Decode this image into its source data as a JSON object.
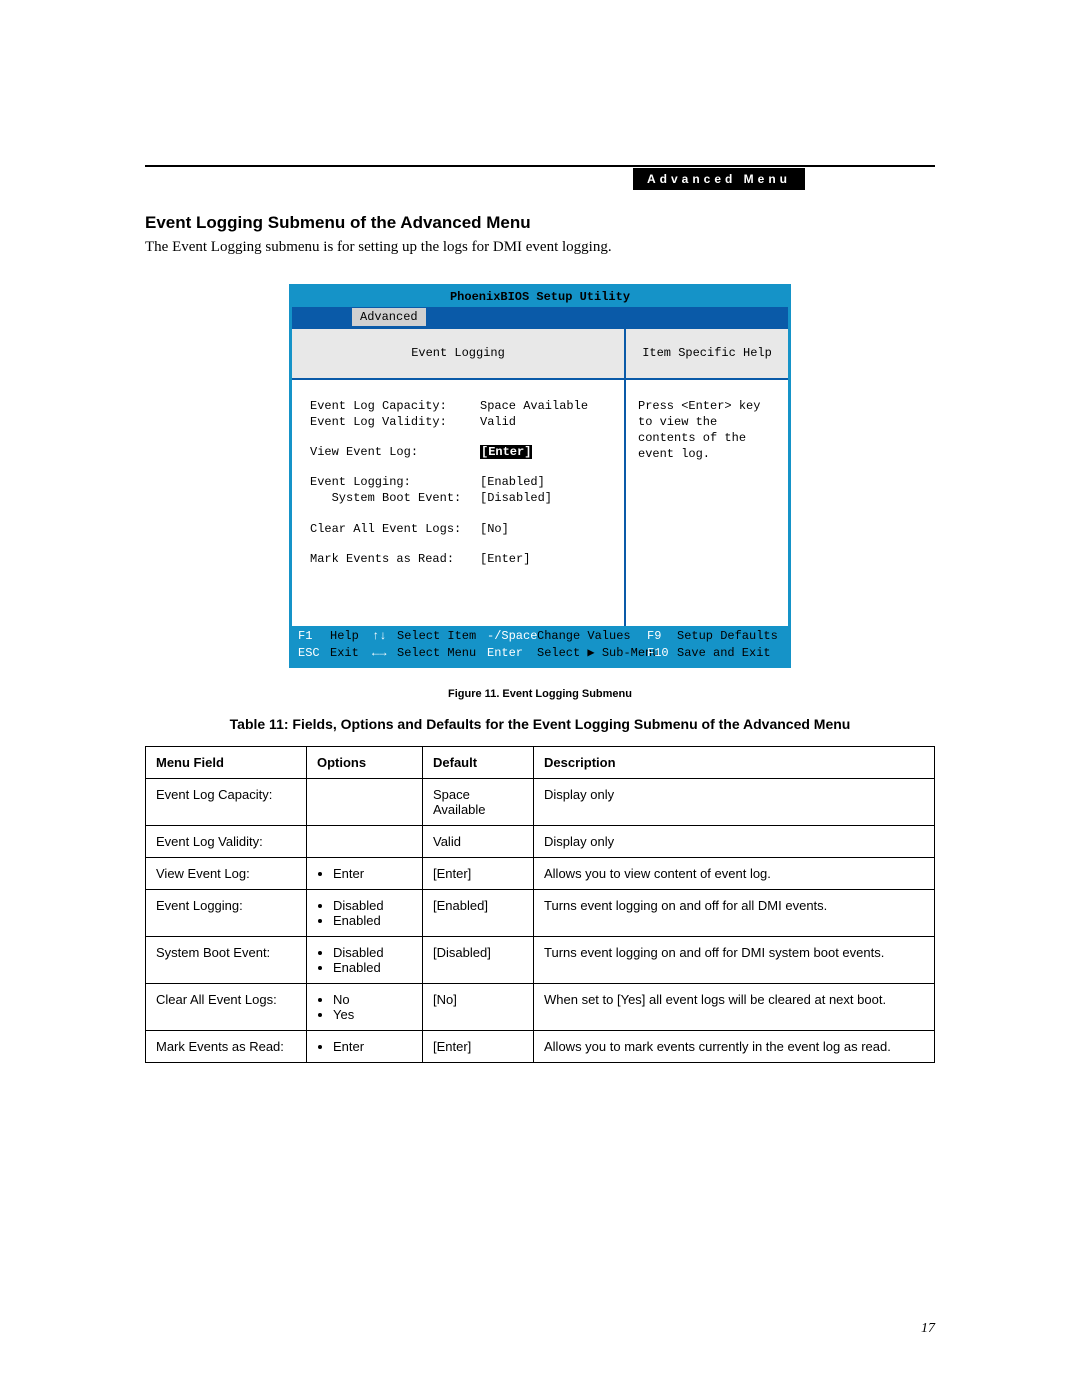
{
  "header": {
    "tab": "Advanced Menu"
  },
  "section": {
    "title": "Event Logging Submenu of the Advanced Menu",
    "intro": "The Event Logging submenu is for setting up the logs for DMI event logging."
  },
  "bios": {
    "title": "PhoenixBIOS Setup Utility",
    "menubar_active": "Advanced",
    "panel_left_title": "Event Logging",
    "panel_right_title": "Item Specific Help",
    "help_text": "Press <Enter> key to view the contents of the event log.",
    "rows": [
      {
        "label": "Event Log Capacity:",
        "value": "Space Available",
        "indent": 0
      },
      {
        "label": "Event Log Validity:",
        "value": "Valid",
        "indent": 0
      },
      {
        "gap": true
      },
      {
        "label": "View Event Log:",
        "value": "[Enter]",
        "indent": 0,
        "selected": true
      },
      {
        "gap": true
      },
      {
        "label": "Event Logging:",
        "value": "[Enabled]",
        "indent": 0
      },
      {
        "label": "System Boot Event:",
        "value": "[Disabled]",
        "indent": 1
      },
      {
        "gap": true
      },
      {
        "label": "Clear All Event Logs:",
        "value": "[No]",
        "indent": 0
      },
      {
        "gap": true
      },
      {
        "label": "Mark Events as Read:",
        "value": "[Enter]",
        "indent": 0
      }
    ],
    "footer": {
      "r1c1k": "F1",
      "r1c1t": "Help",
      "r1c2k": "↑↓",
      "r1c2t": "Select Item",
      "r1c3k": "-/Space",
      "r1c3t": "Change Values",
      "r1c4k": "F9",
      "r1c4t": "Setup Defaults",
      "r2c1k": "ESC",
      "r2c1t": "Exit",
      "r2c2k": "←→",
      "r2c2t": "Select Menu",
      "r2c3k": "Enter",
      "r2c3t": "Select ▶ Sub-Menu",
      "r2c4k": "F10",
      "r2c4t": "Save and Exit"
    }
  },
  "figure_caption": "Figure 11.  Event Logging Submenu",
  "table_title": "Table 11: Fields, Options and Defaults for the Event Logging Submenu of the Advanced Menu",
  "table": {
    "headers": {
      "field": "Menu Field",
      "options": "Options",
      "default": "Default",
      "desc": "Description"
    },
    "rows": [
      {
        "field": "Event Log Capacity:",
        "options": [],
        "default": "Space Available",
        "desc": "Display only"
      },
      {
        "field": "Event Log Validity:",
        "options": [],
        "default": "Valid",
        "desc": "Display only"
      },
      {
        "field": "View Event Log:",
        "options": [
          "Enter"
        ],
        "default": "[Enter]",
        "desc": "Allows you to view content of event log."
      },
      {
        "field": "Event Logging:",
        "options": [
          "Disabled",
          "Enabled"
        ],
        "default": "[Enabled]",
        "desc": "Turns event logging on and off for all DMI events."
      },
      {
        "field": "System Boot Event:",
        "options": [
          "Disabled",
          "Enabled"
        ],
        "default": "[Disabled]",
        "desc": "Turns event logging on and off for DMI system boot events."
      },
      {
        "field": "Clear All Event Logs:",
        "options": [
          "No",
          "Yes"
        ],
        "default": "[No]",
        "desc": "When set to [Yes] all event logs will be cleared at next boot."
      },
      {
        "field": "Mark Events as Read:",
        "options": [
          "Enter"
        ],
        "default": "[Enter]",
        "desc": "Allows you to mark events currently in the event log as read."
      }
    ]
  },
  "page_number": "17"
}
